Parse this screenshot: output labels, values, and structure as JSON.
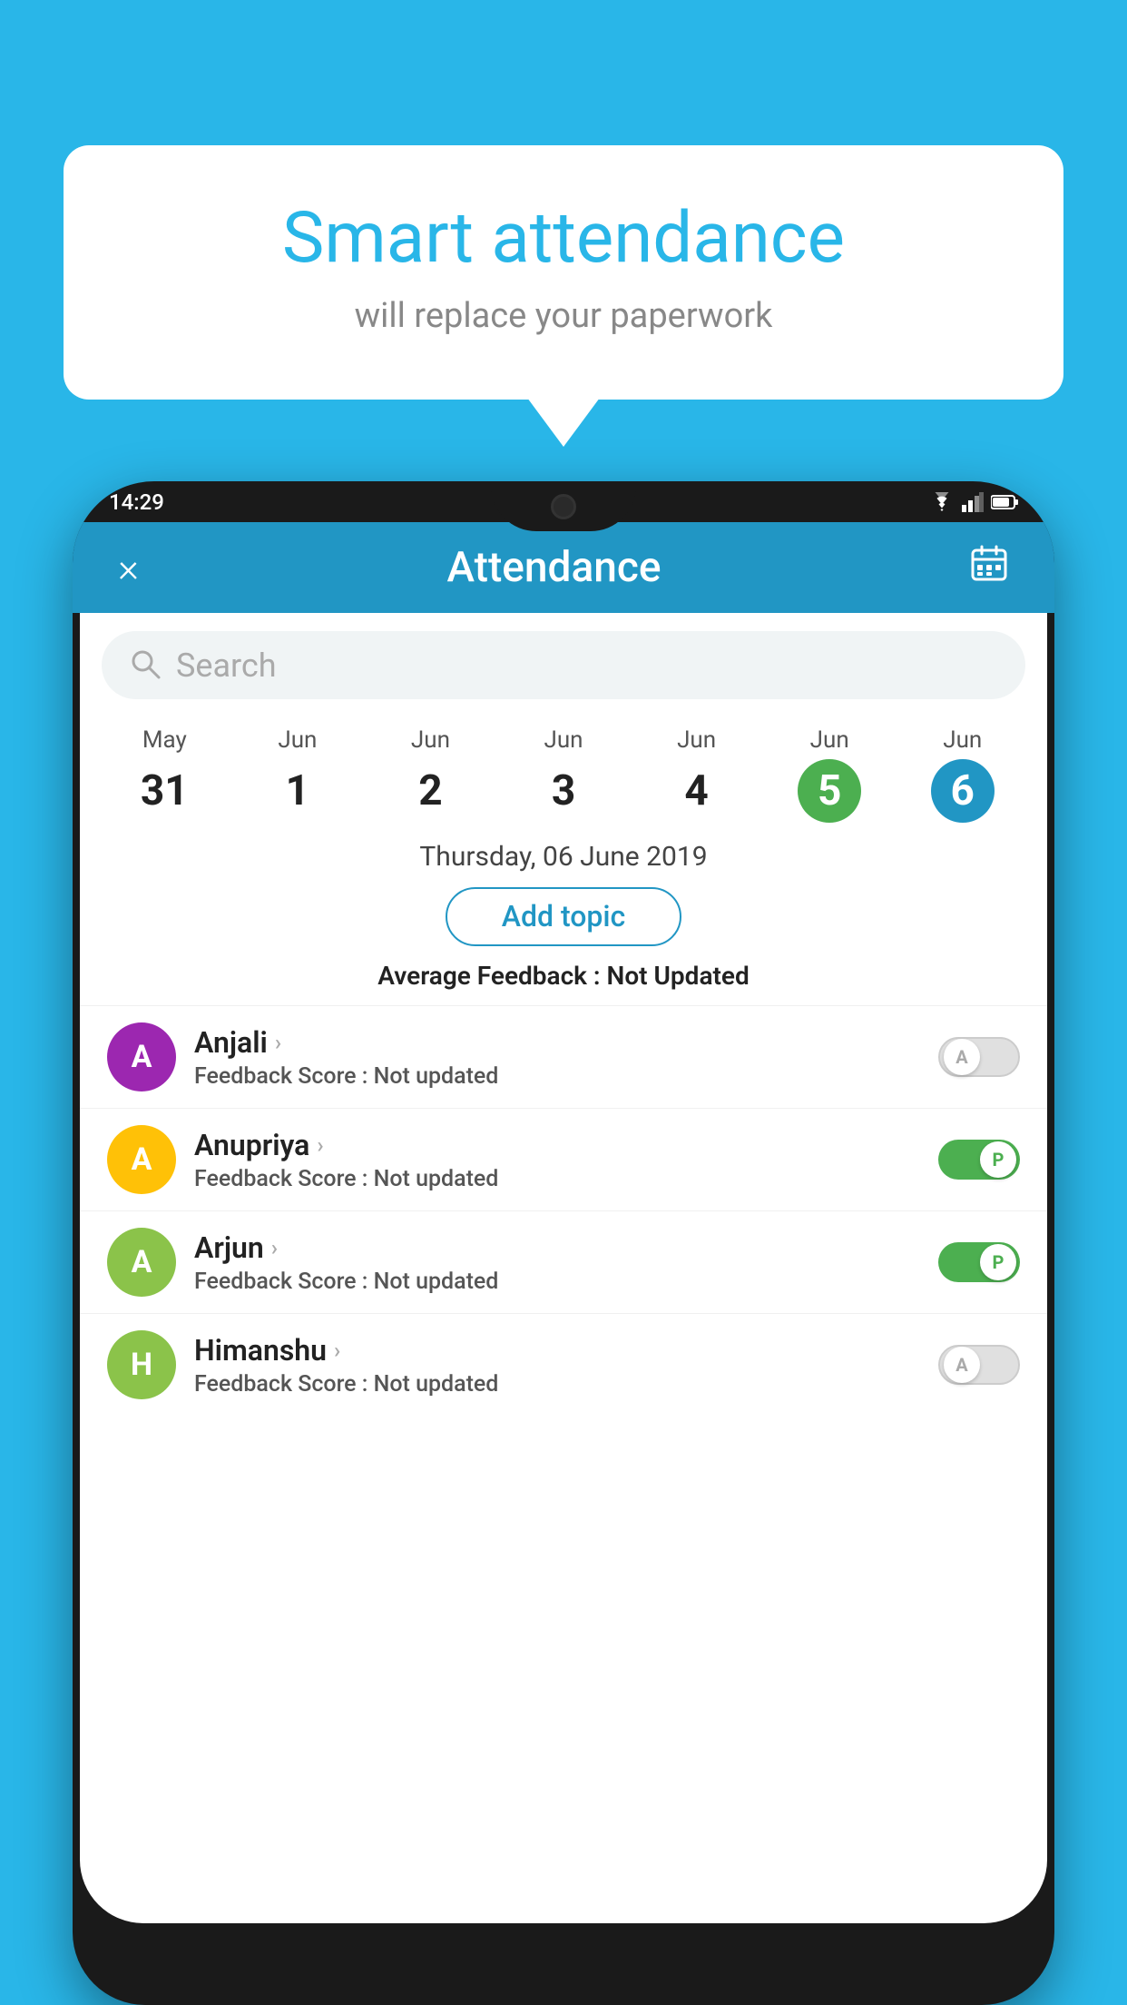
{
  "background_color": "#29b6e8",
  "speech_bubble": {
    "title": "Smart attendance",
    "subtitle": "will replace your paperwork"
  },
  "status_bar": {
    "time": "14:29"
  },
  "app_header": {
    "title": "Attendance",
    "close_label": "×",
    "calendar_label": "📅"
  },
  "search": {
    "placeholder": "Search"
  },
  "dates": [
    {
      "month": "May",
      "day": "31",
      "style": "normal"
    },
    {
      "month": "Jun",
      "day": "1",
      "style": "normal"
    },
    {
      "month": "Jun",
      "day": "2",
      "style": "normal"
    },
    {
      "month": "Jun",
      "day": "3",
      "style": "normal"
    },
    {
      "month": "Jun",
      "day": "4",
      "style": "normal"
    },
    {
      "month": "Jun",
      "day": "5",
      "style": "green"
    },
    {
      "month": "Jun",
      "day": "6",
      "style": "blue"
    }
  ],
  "selected_date": "Thursday, 06 June 2019",
  "add_topic_label": "Add topic",
  "avg_feedback_label": "Average Feedback : ",
  "avg_feedback_value": "Not Updated",
  "students": [
    {
      "name": "Anjali",
      "avatar_letter": "A",
      "avatar_color": "#9c27b0",
      "feedback_label": "Feedback Score : ",
      "feedback_value": "Not updated",
      "toggle_state": "off",
      "toggle_letter": "A"
    },
    {
      "name": "Anupriya",
      "avatar_letter": "A",
      "avatar_color": "#ffc107",
      "feedback_label": "Feedback Score : ",
      "feedback_value": "Not updated",
      "toggle_state": "on",
      "toggle_letter": "P"
    },
    {
      "name": "Arjun",
      "avatar_letter": "A",
      "avatar_color": "#8bc34a",
      "feedback_label": "Feedback Score : ",
      "feedback_value": "Not updated",
      "toggle_state": "on",
      "toggle_letter": "P"
    },
    {
      "name": "Himanshu",
      "avatar_letter": "H",
      "avatar_color": "#8bc34a",
      "feedback_label": "Feedback Score : ",
      "feedback_value": "Not updated",
      "toggle_state": "off",
      "toggle_letter": "A"
    }
  ]
}
